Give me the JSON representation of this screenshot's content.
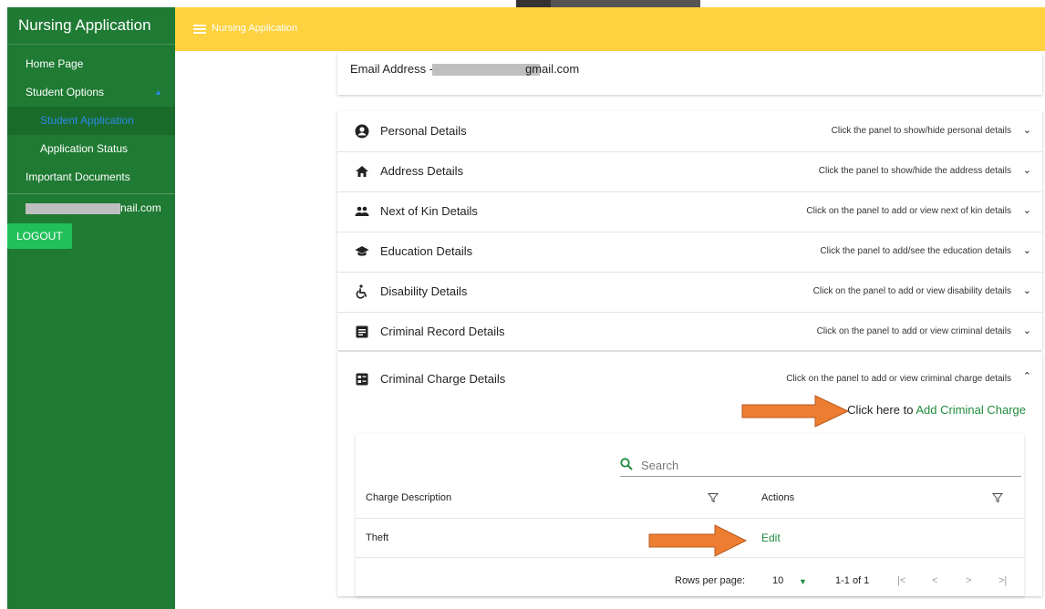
{
  "app": {
    "title": "Nursing Application",
    "topbar_title": "Nursing Application"
  },
  "sidebar": {
    "items": [
      {
        "label": "Home Page"
      },
      {
        "label": "Student Options"
      },
      {
        "label": "Student Application"
      },
      {
        "label": "Application Status"
      },
      {
        "label": "Important Documents"
      }
    ],
    "user_email_visible": "nail.com",
    "logout_label": "LOGOUT"
  },
  "email_card": {
    "prefix": "Email Address -",
    "visible_suffix": "gmail.com"
  },
  "panels": [
    {
      "title": "Personal Details",
      "hint": "Click the panel to show/hide personal details",
      "icon": "account-circle-icon"
    },
    {
      "title": "Address Details",
      "hint": "Click the panel to show/hide the address details",
      "icon": "home-icon"
    },
    {
      "title": "Next of Kin Details",
      "hint": "Click on the panel to add or view next of kin details",
      "icon": "people-icon"
    },
    {
      "title": "Education Details",
      "hint": "Click the panel to add/see the education details",
      "icon": "school-icon"
    },
    {
      "title": "Disability Details",
      "hint": "Click on the panel to add or view disability details",
      "icon": "accessible-icon"
    },
    {
      "title": "Criminal Record Details",
      "hint": "Click on the panel to add or view criminal details",
      "icon": "document-icon"
    }
  ],
  "charge_panel": {
    "title": "Criminal Charge Details",
    "hint": "Click on the panel to add or view criminal charge details",
    "icon": "badge-icon",
    "add_prefix": "Click here to",
    "add_link": "Add Criminal Charge"
  },
  "table": {
    "search_placeholder": "Search",
    "headers": [
      "Charge Description",
      "Actions"
    ],
    "rows": [
      {
        "description": "Theft",
        "action": "Edit"
      }
    ],
    "rows_per_page_label": "Rows per page:",
    "rows_per_page_value": "10",
    "range": "1-1 of 1"
  },
  "colors": {
    "sidebar": "#1f7a33",
    "topbar": "#fdd13f",
    "accent_green": "#1f8a3b",
    "arrow": "#ed7d31",
    "logout": "#22c05a"
  }
}
